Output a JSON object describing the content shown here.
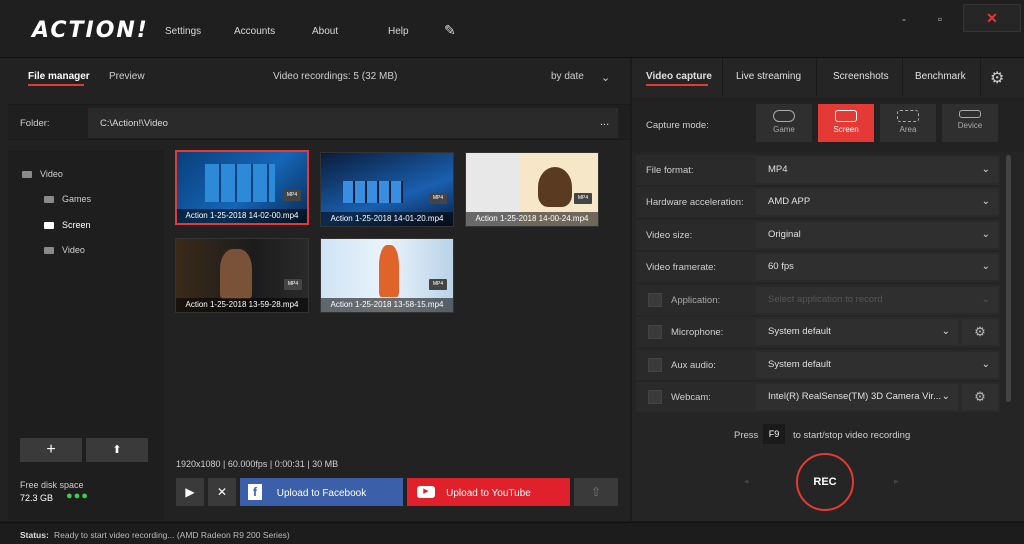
{
  "app": {
    "logo": "ACTION!"
  },
  "menu": {
    "settings": "Settings",
    "accounts": "Accounts",
    "about": "About",
    "help": "Help",
    "minimize": "-",
    "close": "✕",
    "brush": "✎"
  },
  "left": {
    "tabs": {
      "file_manager": "File manager",
      "preview": "Preview"
    },
    "recordings": "Video recordings: 5 (32 MB)",
    "sort": "by date",
    "folder_label": "Folder:",
    "folder_path": "C:\\Action!\\Video",
    "folder_more": "...",
    "tree": {
      "root": "Video",
      "games": "Games",
      "screen": "Screen",
      "video": "Video"
    },
    "add": "+",
    "disk_label": "Free disk space",
    "disk_value": "72.3 GB",
    "thumbs": [
      {
        "name": "Action 1-25-2018 14-02-00.mp4",
        "badge": "MP4"
      },
      {
        "name": "Action 1-25-2018 14-01-20.mp4",
        "badge": "MP4"
      },
      {
        "name": "Action 1-25-2018 14-00-24.mp4",
        "badge": "MP4"
      },
      {
        "name": "Action 1-25-2018 13-59-28.mp4",
        "badge": "MP4"
      },
      {
        "name": "Action 1-25-2018 13-58-15.mp4",
        "badge": "MP4"
      }
    ],
    "info": "1920x1080 | 60.000fps | 0:00:31 | 30 MB",
    "play": "▶",
    "delete": "✕",
    "facebook": "Upload to Facebook",
    "youtube": "Upload to YouTube",
    "upload": "⇧"
  },
  "right": {
    "tabs": {
      "video_capture": "Video capture",
      "live_streaming": "Live streaming",
      "screenshots": "Screenshots",
      "benchmark": "Benchmark"
    },
    "capture_mode_label": "Capture mode:",
    "modes": {
      "game": "Game",
      "screen": "Screen",
      "area": "Area",
      "device": "Device"
    },
    "settings": [
      {
        "label": "File format:",
        "value": "MP4"
      },
      {
        "label": "Hardware acceleration:",
        "value": "AMD APP"
      },
      {
        "label": "Video size:",
        "value": "Original"
      },
      {
        "label": "Video framerate:",
        "value": "60 fps"
      },
      {
        "label": "Application:",
        "value": "Select application to record"
      },
      {
        "label": "Microphone:",
        "value": "System default"
      },
      {
        "label": "Aux audio:",
        "value": "System default"
      },
      {
        "label": "Webcam:",
        "value": "Intel(R) RealSense(TM) 3D Camera Vir..."
      }
    ],
    "press": "Press",
    "key": "F9",
    "hint": "to start/stop video recording",
    "rec": "REC"
  },
  "status": {
    "label": "Status:",
    "text": "Ready to start video recording... (AMD Radeon R9 200 Series)"
  },
  "colors": {
    "accent": "#e53935",
    "facebook": "#3b5fa8",
    "youtube": "#e0202a"
  }
}
